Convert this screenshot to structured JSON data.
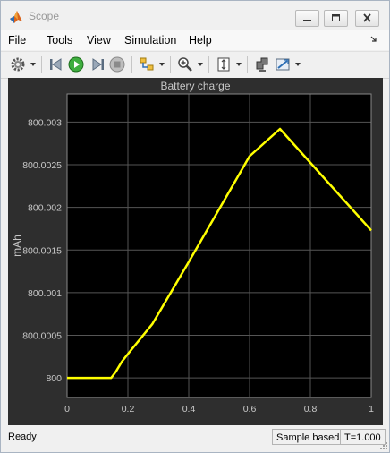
{
  "window": {
    "title": "Scope"
  },
  "menu": {
    "items": [
      "File",
      "Tools",
      "View",
      "Simulation",
      "Help"
    ]
  },
  "toolbar": {
    "icons": [
      "settings-gear-icon",
      "step-back-icon",
      "run-icon",
      "step-forward-icon",
      "stop-icon",
      "signal-selector-icon",
      "zoom-in-icon",
      "scale-axes-icon",
      "highlight-block-icon",
      "cursor-measurements-icon"
    ]
  },
  "status": {
    "ready": "Ready",
    "mode": "Sample based",
    "time": "T=1.000"
  },
  "colors": {
    "plot_background": "#000000",
    "figure_background": "#2e2e2e",
    "trace": "#ffff00",
    "grid": "#555555"
  },
  "chart_data": {
    "type": "line",
    "title": "Battery charge",
    "xlabel": "",
    "ylabel": "mAh",
    "xlim": [
      0,
      1
    ],
    "ylim": [
      799.99977,
      800.00333
    ],
    "xticks": [
      0,
      0.2,
      0.4,
      0.6,
      0.8,
      1
    ],
    "xtick_labels": [
      "0",
      "0.2",
      "0.4",
      "0.6",
      "0.8",
      "1"
    ],
    "yticks": [
      800,
      800.0005,
      800.001,
      800.0015,
      800.002,
      800.0025,
      800.003
    ],
    "ytick_labels": [
      "800",
      "800.0005",
      "800.001",
      "800.0015",
      "800.002",
      "800.0025",
      "800.003"
    ],
    "grid": true,
    "series": [
      {
        "color": "#ffff00",
        "x": [
          0,
          0.145,
          0.16,
          0.18,
          0.2,
          0.28,
          0.4,
          0.5,
          0.6,
          0.7,
          1.0
        ],
        "y": [
          800.0,
          800.0,
          800.00007,
          800.00019,
          800.00028,
          800.00063,
          800.00136,
          800.00198,
          800.0026,
          800.00292,
          800.00173
        ]
      }
    ]
  }
}
